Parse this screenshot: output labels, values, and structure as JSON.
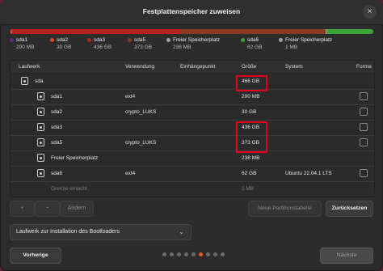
{
  "window": {
    "title": "Festplattenspeicher zuweisen",
    "close_glyph": "×"
  },
  "usage_bar": {
    "segments": [
      {
        "name": "sda1",
        "color": "#5b2a86",
        "fraction": 0.0004
      },
      {
        "name": "sda2",
        "color": "#e04a1f",
        "fraction": 0.0001
      },
      {
        "name": "sda3",
        "color": "#b5241c",
        "fraction": 0.469
      },
      {
        "name": "sda5",
        "color": "#8a3a1e",
        "fraction": 0.402
      },
      {
        "name": "free",
        "color": "#a1a1a1",
        "fraction": 0.0003
      },
      {
        "name": "sda6",
        "color": "#3ea33a",
        "fraction": 0.129
      }
    ]
  },
  "legend": [
    {
      "name": "sda1",
      "size": "200 MB",
      "color": "#5b2a86"
    },
    {
      "name": "sda2",
      "size": "30 GB",
      "color": "#e04a1f"
    },
    {
      "name": "sda3",
      "size": "436 GB",
      "color": "#b5241c"
    },
    {
      "name": "sda5",
      "size": "373 GB",
      "color": "#8a3a1e"
    },
    {
      "name": "Freier Speicherplatz",
      "size": "238 MB",
      "color": "#a1a1a1"
    },
    {
      "name": "sda6",
      "size": "62 GB",
      "color": "#3ea33a"
    },
    {
      "name": "Freier Speicherplatz",
      "size": "1 MB",
      "color": "#a1a1a1"
    }
  ],
  "table": {
    "headers": {
      "device": "Laufwerk",
      "usage": "Verwendung",
      "mount": "Einhängepunkt",
      "size": "Größe",
      "system": "System",
      "format": "Forma"
    },
    "rows": [
      {
        "device": "sda",
        "usage": "",
        "size": "466 GB",
        "system": "",
        "indent": false,
        "icon": "disk-icon",
        "checkbox": false,
        "dim": false
      },
      {
        "device": "sda1",
        "usage": "ext4",
        "size": "200 MB",
        "system": "",
        "indent": true,
        "icon": "partition-icon",
        "checkbox": true,
        "dim": false
      },
      {
        "device": "sda2",
        "usage": "crypto_LUKS",
        "size": "30 GB",
        "system": "",
        "indent": true,
        "icon": "partition-icon",
        "checkbox": true,
        "dim": false
      },
      {
        "device": "sda3",
        "usage": "",
        "size": "436 GB",
        "system": "",
        "indent": true,
        "icon": "partition-icon",
        "checkbox": true,
        "dim": false
      },
      {
        "device": "sda5",
        "usage": "crypto_LUKS",
        "size": "373 GB",
        "system": "",
        "indent": true,
        "icon": "partition-icon",
        "checkbox": true,
        "dim": false
      },
      {
        "device": "Freier Speicherplatz",
        "usage": "",
        "size": "238 MB",
        "system": "",
        "indent": true,
        "icon": "partition-icon",
        "checkbox": false,
        "dim": false
      },
      {
        "device": "sda6",
        "usage": "ext4",
        "size": "62 GB",
        "system": "Ubuntu 22.04.1 LTS",
        "indent": true,
        "icon": "partition-icon",
        "checkbox": true,
        "dim": false
      },
      {
        "device": "Grenze erreicht",
        "usage": "",
        "size": "1 MB",
        "system": "",
        "indent": true,
        "icon": "",
        "checkbox": false,
        "dim": true
      }
    ]
  },
  "toolbar": {
    "add": "+",
    "remove": "−",
    "change": "Ändern",
    "new_table": "Neue Partitionstabelle",
    "reset": "Zurücksetzen"
  },
  "bootloader": {
    "label": "Laufwerk zur Installation des Bootloaders",
    "chevron": "⌄"
  },
  "footer": {
    "previous": "Vorherige",
    "next": "Nächste"
  },
  "pager": {
    "total": 9,
    "active": 5
  },
  "colors": {
    "highlight": "#e0001a",
    "window_bg": "#2c2c2c"
  }
}
